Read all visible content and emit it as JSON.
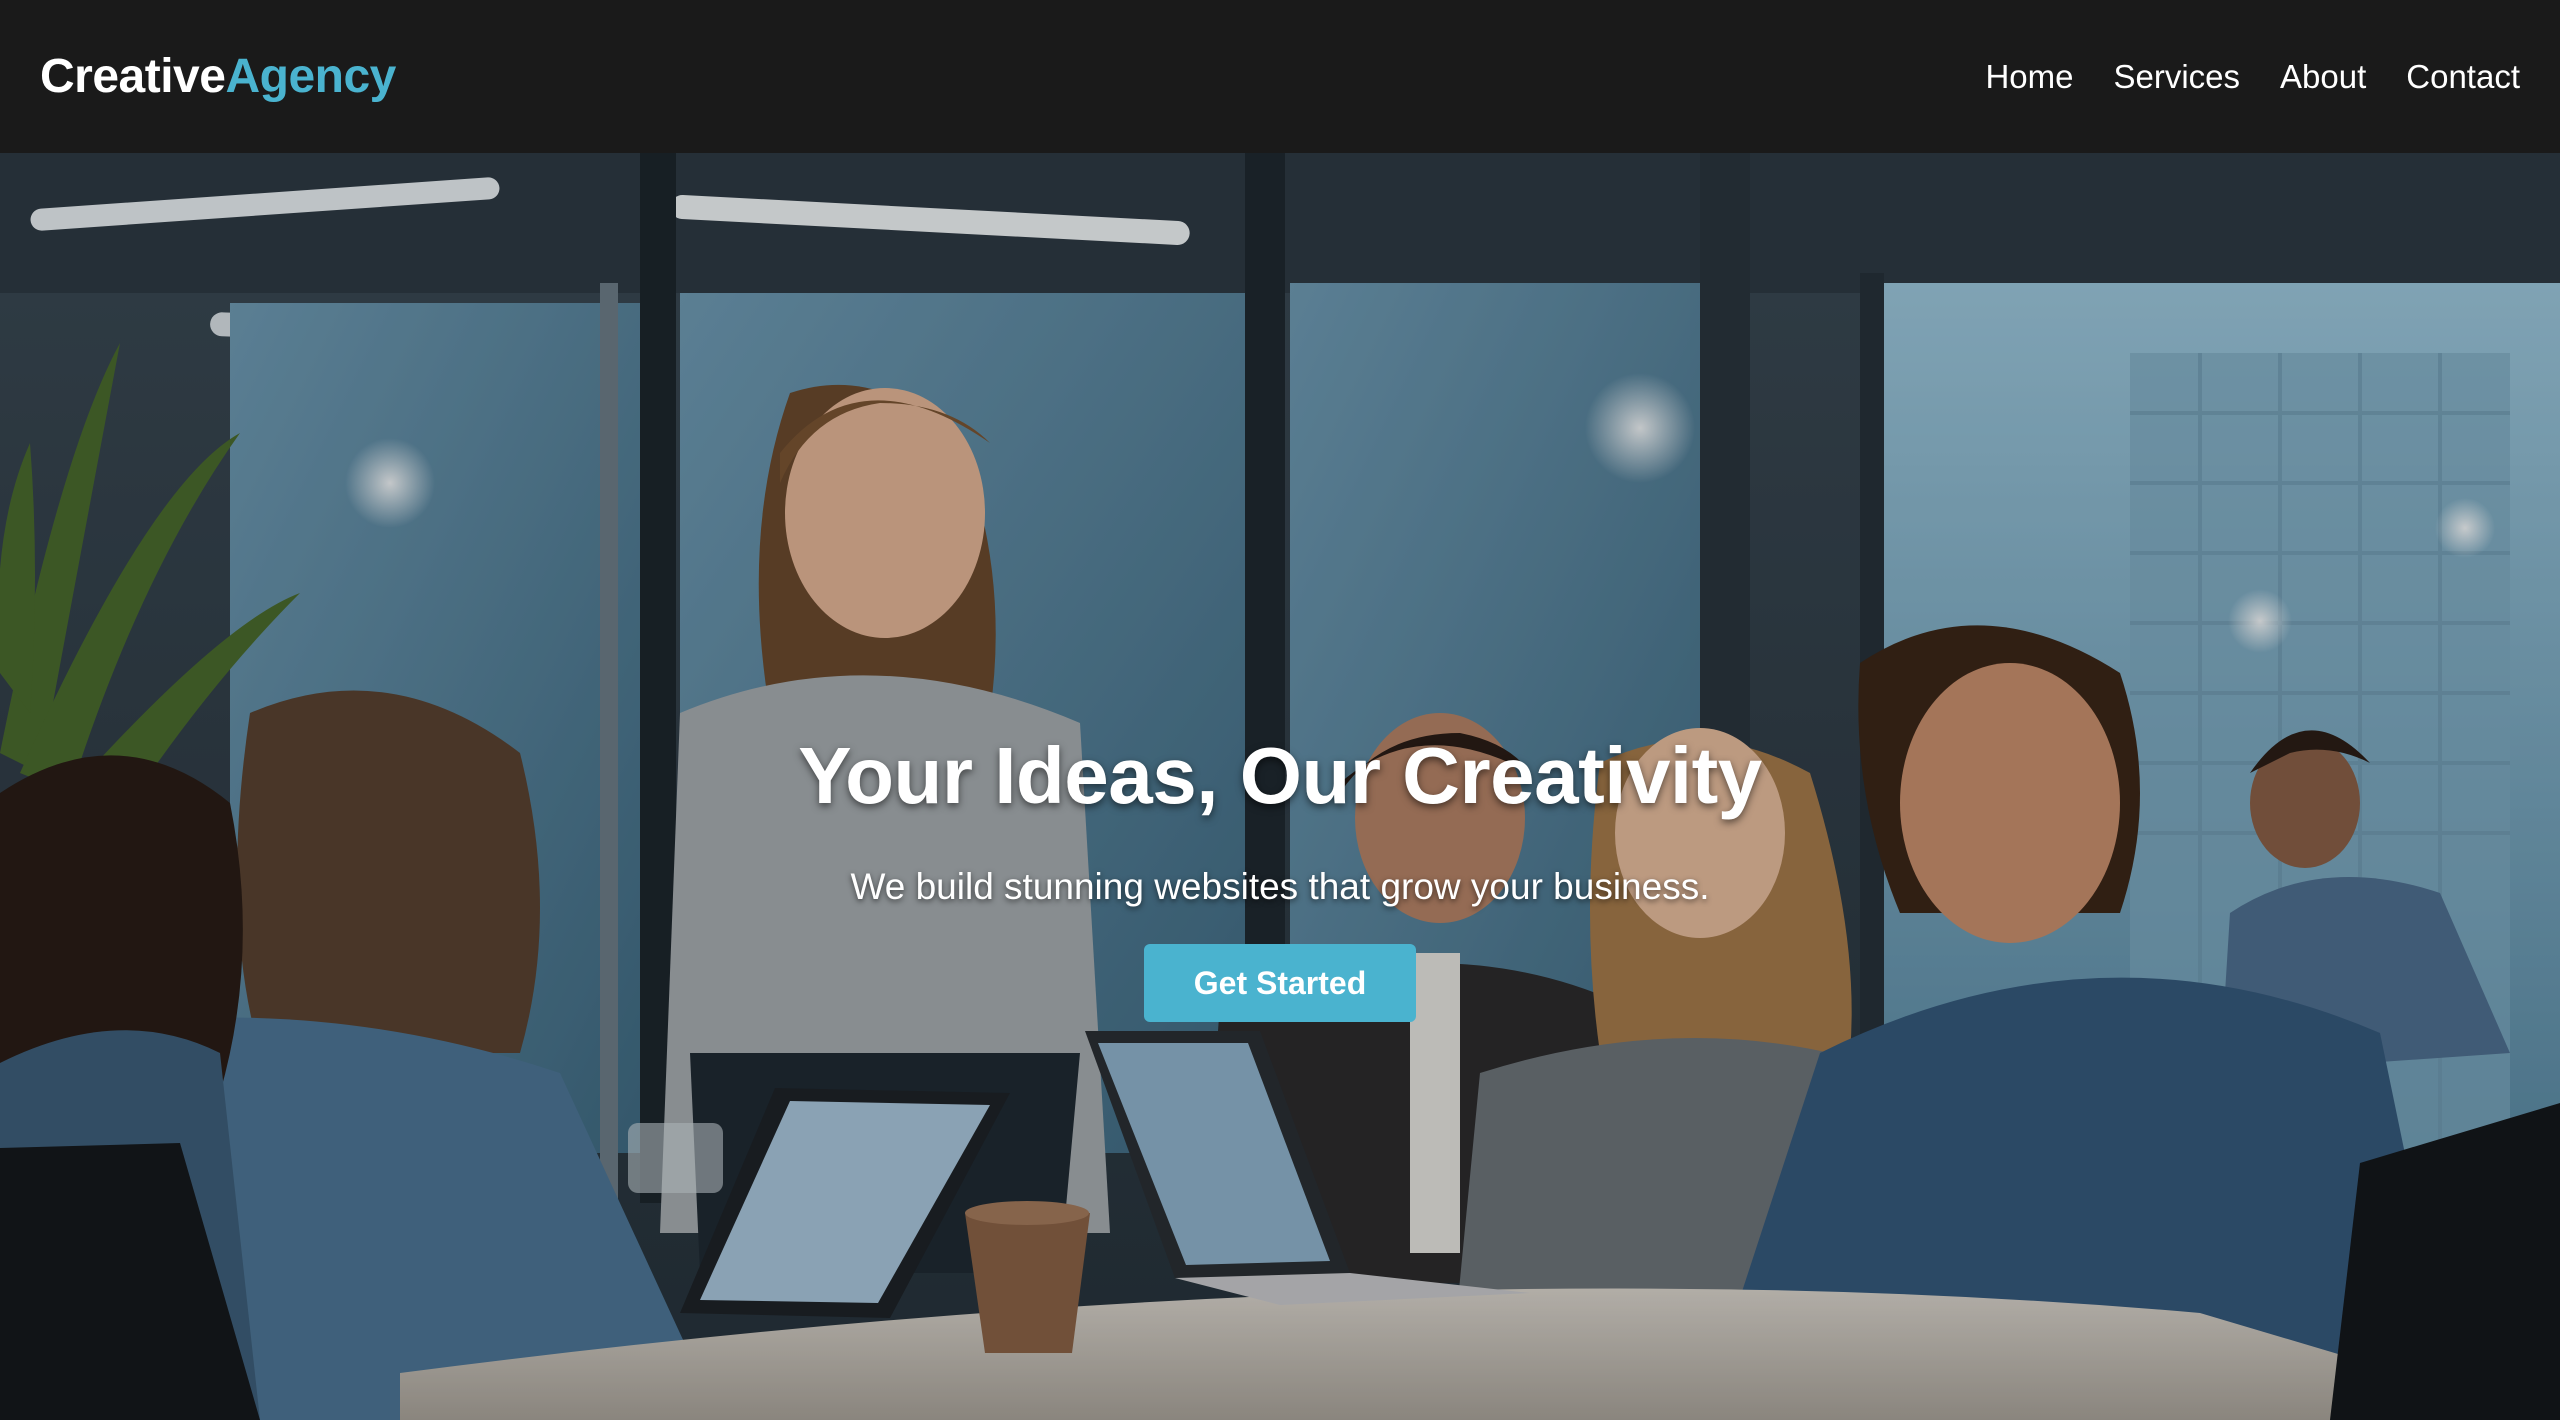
{
  "header": {
    "logo_primary": "Creative",
    "logo_accent": "Agency",
    "nav": [
      {
        "label": "Home"
      },
      {
        "label": "Services"
      },
      {
        "label": "About"
      },
      {
        "label": "Contact"
      }
    ]
  },
  "hero": {
    "title": "Your Ideas, Our Creativity",
    "subtitle": "We build stunning websites that grow your business.",
    "cta_label": "Get Started",
    "background_image": "office-team-meeting-photo"
  },
  "colors": {
    "accent": "#4ab3cf",
    "navbar_bg": "#1a1a1a",
    "text": "#ffffff"
  }
}
